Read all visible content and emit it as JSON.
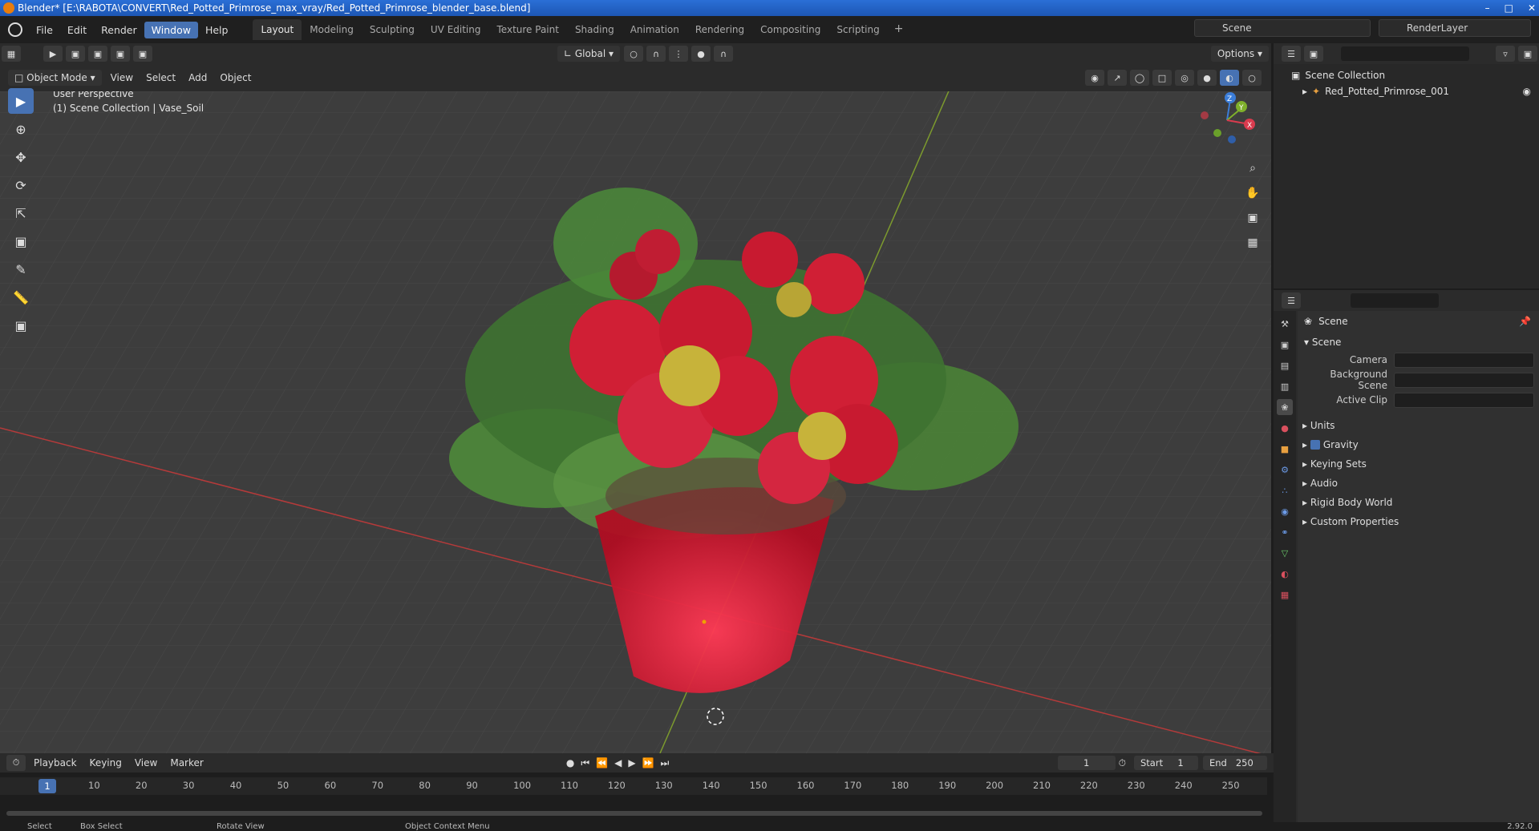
{
  "title_bar": {
    "title": "Blender* [E:\\RABOTA\\CONVERT\\Red_Potted_Primrose_max_vray/Red_Potted_Primrose_blender_base.blend]",
    "min": "–",
    "max": "□",
    "close": "✕"
  },
  "menu": [
    "File",
    "Edit",
    "Render",
    "Window",
    "Help"
  ],
  "menu_active": "Window",
  "workspaces": [
    "Layout",
    "Modeling",
    "Sculpting",
    "UV Editing",
    "Texture Paint",
    "Shading",
    "Animation",
    "Rendering",
    "Compositing",
    "Scripting"
  ],
  "workspace_active": "Layout",
  "workspace_add": "+",
  "scene_selector": "Scene",
  "layer_selector": "RenderLayer",
  "viewport_header": {
    "transform_orientation": "Global",
    "options": "Options",
    "mode": "Object Mode",
    "menus": [
      "View",
      "Select",
      "Add",
      "Object"
    ]
  },
  "viewport": {
    "perspective": "User Perspective",
    "collection_info": "(1) Scene Collection | Vase_Soil",
    "gizmo": {
      "x": "X",
      "y": "Y",
      "z": "Z"
    }
  },
  "outliner": {
    "root": "Scene Collection",
    "child": "Red_Potted_Primrose_001"
  },
  "properties": {
    "title": "Scene",
    "panel": "Scene",
    "fields": [
      "Camera",
      "Background Scene",
      "Active Clip"
    ],
    "subpanels": [
      "Units",
      "Gravity",
      "Keying Sets",
      "Audio",
      "Rigid Body World",
      "Custom Properties"
    ]
  },
  "timeline": {
    "menus": [
      "Playback",
      "Keying",
      "View",
      "Marker"
    ],
    "current_frame": "1",
    "start_label": "Start",
    "start": "1",
    "end_label": "End",
    "end": "250",
    "frames": [
      "1",
      "10",
      "20",
      "30",
      "40",
      "50",
      "60",
      "70",
      "80",
      "90",
      "100",
      "110",
      "120",
      "130",
      "140",
      "150",
      "160",
      "170",
      "180",
      "190",
      "200",
      "210",
      "220",
      "230",
      "240",
      "250"
    ]
  },
  "status_bar": {
    "select": "Select",
    "box_select": "Box Select",
    "rotate_view": "Rotate View",
    "context_menu": "Object Context Menu",
    "version": "2.92.0"
  },
  "colors": {
    "accent": "#4772b3",
    "pot": "#e8122c",
    "petal": "#d01f35",
    "leaf": "#4e8a3a"
  }
}
